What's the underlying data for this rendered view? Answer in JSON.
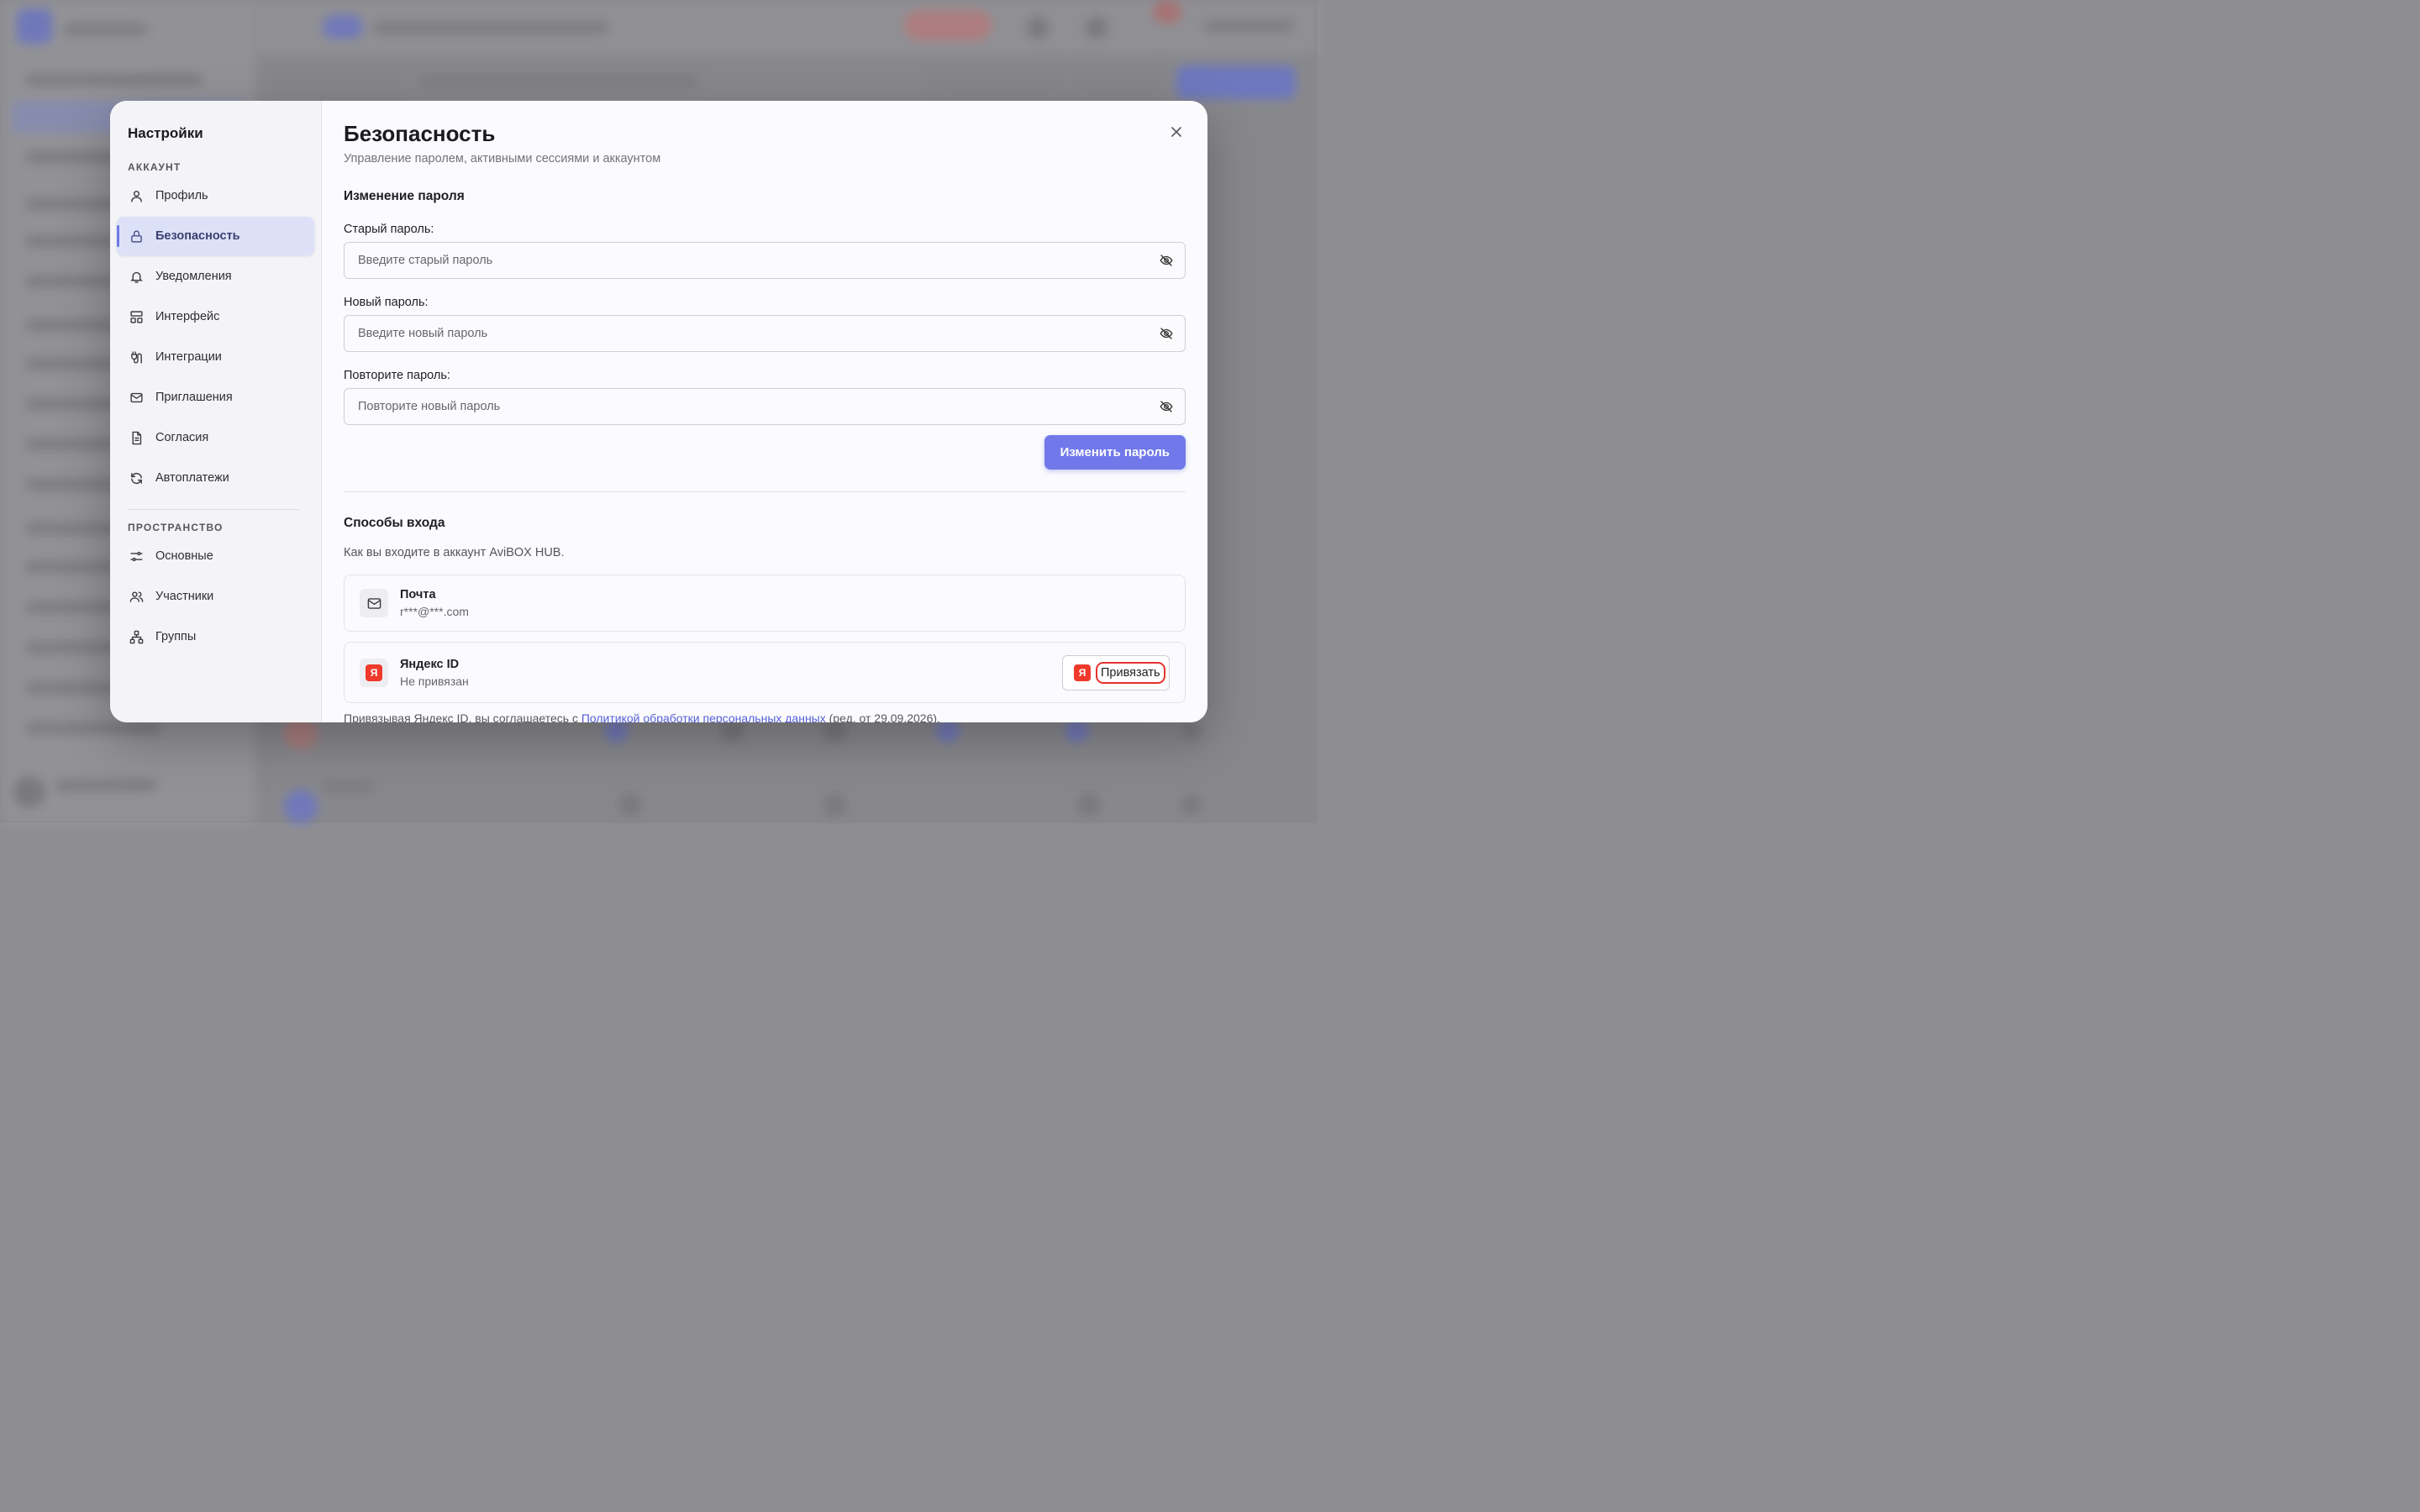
{
  "settings": {
    "title": "Настройки",
    "sections": {
      "account": "АККАУНТ",
      "space": "ПРОСТРАНСТВО"
    },
    "account_items": [
      {
        "label": "Профиль",
        "icon": "user-icon"
      },
      {
        "label": "Безопасность",
        "icon": "lock-icon",
        "active": true
      },
      {
        "label": "Уведомления",
        "icon": "bell-icon"
      },
      {
        "label": "Интерфейс",
        "icon": "layout-icon"
      },
      {
        "label": "Интеграции",
        "icon": "plug-icon"
      },
      {
        "label": "Приглашения",
        "icon": "mail-icon"
      },
      {
        "label": "Согласия",
        "icon": "document-icon"
      },
      {
        "label": "Автоплатежи",
        "icon": "refresh-icon"
      }
    ],
    "space_items": [
      {
        "label": "Основные",
        "icon": "sliders-icon"
      },
      {
        "label": "Участники",
        "icon": "users-icon"
      },
      {
        "label": "Группы",
        "icon": "hierarchy-icon"
      }
    ]
  },
  "page": {
    "title": "Безопасность",
    "subtitle": "Управление паролем, активными сессиями и аккаунтом"
  },
  "password": {
    "heading": "Изменение пароля",
    "old_label": "Старый пароль:",
    "old_placeholder": "Введите старый пароль",
    "new_label": "Новый пароль:",
    "new_placeholder": "Введите новый пароль",
    "repeat_label": "Повторите пароль:",
    "repeat_placeholder": "Повторите новый пароль",
    "submit": "Изменить пароль"
  },
  "login_methods": {
    "heading": "Способы входа",
    "description": "Как вы входите в аккаунт AviBOX HUB.",
    "email": {
      "title": "Почта",
      "value": "r***@***.com"
    },
    "yandex": {
      "title": "Яндекс ID",
      "status": "Не привязан",
      "badge": "Я",
      "button": "Привязать"
    },
    "consent_before": "Привязывая Яндекс ID, вы соглашаетесь с ",
    "consent_link": "Политикой обработки персональных данных",
    "consent_after": " (ред. от 29.09.2026)."
  },
  "colors": {
    "accent": "#7078ea",
    "active_nav_bg": "#dde1f8",
    "yandex_red": "#f0392b"
  }
}
